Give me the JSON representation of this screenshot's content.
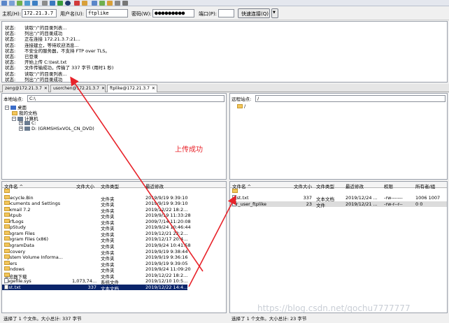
{
  "quickconnect": {
    "host_label": "主机(H):",
    "host_value": "172.21.3.7",
    "user_label": "用户名(U):",
    "user_value": "ftplike",
    "pass_label": "密码(W):",
    "pass_value": "●●●●●●●●●",
    "port_label": "端口(P):",
    "port_value": "",
    "connect_label": "快速连接(Q)",
    "dropdown_label": "▼"
  },
  "log": [
    {
      "status": "状态:",
      "message": "读取“/”的目录列表..."
    },
    {
      "status": "状态:",
      "message": "列出“/”的目录成功"
    },
    {
      "status": "状态:",
      "message": "正在连接 172.21.3.7:21..."
    },
    {
      "status": "状态:",
      "message": "连接建立，等待欢迎消息..."
    },
    {
      "status": "状态:",
      "message": "不安全的服务器，不支持 FTP over TLS。"
    },
    {
      "status": "状态:",
      "message": "已登录"
    },
    {
      "status": "状态:",
      "message": "开始上传 C:\\test.txt"
    },
    {
      "status": "状态:",
      "message": "文件传输成功，传输了 337 字节 (用时1 秒)"
    },
    {
      "status": "状态:",
      "message": "读取“/”的目录列表..."
    },
    {
      "status": "状态:",
      "message": "列出“/”的目录成功"
    }
  ],
  "tabs": [
    {
      "label": "zeng@172.21.3.7",
      "close": "✕"
    },
    {
      "label": "usorchen@172.21.3.7",
      "close": "✕"
    },
    {
      "label": "ftplike@172.21.3.7",
      "close": "✕"
    }
  ],
  "local": {
    "site_label": "本地站点:",
    "site_path": "C:\\",
    "tree": [
      {
        "label": "桌面",
        "icon": "desktop-icon",
        "expander": "−"
      },
      {
        "label": "我的文档",
        "icon": "folder-icon",
        "expander": ""
      },
      {
        "label": "计算机",
        "icon": "computer-icon",
        "expander": "−"
      },
      {
        "label": "C:",
        "icon": "drive-icon",
        "expander": "+"
      },
      {
        "label": "D: (GRMSHSxVOL_CN_DVD)",
        "icon": "dvd-icon",
        "expander": "+"
      }
    ],
    "columns": {
      "name": "文件名 ^",
      "size": "文件大小",
      "type": "文件类型",
      "modified": "最近修改"
    },
    "files": [
      {
        "name": "..",
        "size": "",
        "type": "",
        "modified": "",
        "icon": "folder-icon"
      },
      {
        "name": "$Recycle.Bin",
        "size": "",
        "type": "文件夹",
        "modified": "2019/9/19 9:39:10",
        "icon": "folder-icon"
      },
      {
        "name": "Documents and Settings",
        "size": "",
        "type": "文件夹",
        "modified": "2019/9/19 9:39:10",
        "icon": "folder-icon"
      },
      {
        "name": "Foxmail 7.2",
        "size": "",
        "type": "文件夹",
        "modified": "2019/12/22 18:2...",
        "icon": "folder-icon"
      },
      {
        "name": "inetpub",
        "size": "",
        "type": "文件夹",
        "modified": "2019/9/19 11:33:28",
        "icon": "folder-icon"
      },
      {
        "name": "PerfLogs",
        "size": "",
        "type": "文件夹",
        "modified": "2009/7/14 11:20:08",
        "icon": "folder-icon"
      },
      {
        "name": "PhpStudy",
        "size": "",
        "type": "文件夹",
        "modified": "2019/9/24 10:46:44",
        "icon": "folder-icon"
      },
      {
        "name": "Program Files",
        "size": "",
        "type": "文件夹",
        "modified": "2019/12/21 22:2...",
        "icon": "folder-icon"
      },
      {
        "name": "Program Files (x86)",
        "size": "",
        "type": "文件夹",
        "modified": "2019/12/17 20:4...",
        "icon": "folder-icon"
      },
      {
        "name": "ProgramData",
        "size": "",
        "type": "文件夹",
        "modified": "2019/9/24 10:41:58",
        "icon": "folder-icon"
      },
      {
        "name": "Recovery",
        "size": "",
        "type": "文件夹",
        "modified": "2019/9/19 9:38:44",
        "icon": "folder-icon"
      },
      {
        "name": "System Volume Informa...",
        "size": "",
        "type": "文件夹",
        "modified": "2019/9/19 9:36:16",
        "icon": "folder-icon"
      },
      {
        "name": "Users",
        "size": "",
        "type": "文件夹",
        "modified": "2019/9/19 9:39:05",
        "icon": "folder-icon"
      },
      {
        "name": "Windows",
        "size": "",
        "type": "文件夹",
        "modified": "2019/9/24 11:09:20",
        "icon": "folder-icon"
      },
      {
        "name": "浏览器下载",
        "size": "",
        "type": "文件夹",
        "modified": "2019/12/22 18:2...",
        "icon": "folder-icon"
      },
      {
        "name": "pagefile.sys",
        "size": "1,073,74...",
        "type": "系统文件",
        "modified": "2019/12/10 10:5...",
        "icon": "file-icon"
      },
      {
        "name": "test.txt",
        "size": "337",
        "type": "文本文档",
        "modified": "2019/12/22 14:4...",
        "icon": "file-icon",
        "selected": true
      }
    ],
    "status": "选择了 1 个文件。大小总计: 337 字节"
  },
  "remote": {
    "site_label": "远程站点:",
    "site_path": "/",
    "tree": [
      {
        "label": "/",
        "icon": "folder-icon"
      }
    ],
    "columns": {
      "name": "文件名 ^",
      "size": "文件大小",
      "type": "文件类型",
      "modified": "最近修改",
      "perm": "权限",
      "owner": "所有者/组"
    },
    "files": [
      {
        "name": "..",
        "size": "",
        "type": "",
        "modified": "",
        "perm": "",
        "owner": "",
        "icon": "folder-icon"
      },
      {
        "name": "test.txt",
        "size": "337",
        "type": "文本文档",
        "modified": "2019/12/24 ...",
        "perm": "-rw-------",
        "owner": "1006 1007",
        "icon": "file-icon"
      },
      {
        "name": "vir_user_ftplike",
        "size": "23",
        "type": "文件",
        "modified": "2019/12/21 ...",
        "perm": "-rw-r--r--",
        "owner": "0 0",
        "icon": "file-icon"
      }
    ],
    "status": "选择了 1 个文件。大小总计: 23 字节"
  },
  "annotation": "上传成功",
  "watermark": "https://blog.csdn.net/qochu7777777",
  "colors": {
    "annotation": "#e8232a",
    "selection": "#0a246a"
  }
}
